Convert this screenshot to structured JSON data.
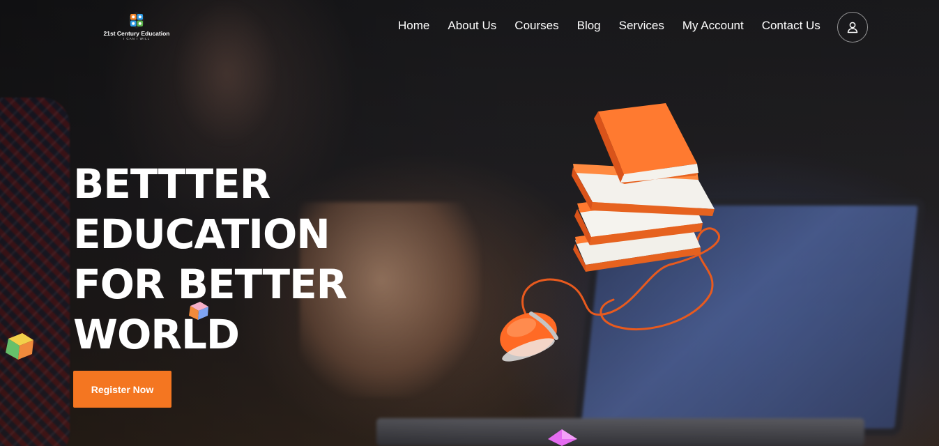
{
  "brand": {
    "name": "21st Century Education",
    "tagline": "I CAN I WILL",
    "colors": {
      "accent": "#f47621",
      "logo_blue": "#2e9be3",
      "logo_orange": "#f2862b",
      "logo_green": "#5bb34a",
      "logo_red": "#e04b4b"
    }
  },
  "nav": {
    "items": [
      {
        "label": "Home"
      },
      {
        "label": "About Us"
      },
      {
        "label": "Courses"
      },
      {
        "label": "Blog"
      },
      {
        "label": "Services"
      },
      {
        "label": "My Account"
      },
      {
        "label": "Contact Us"
      }
    ],
    "account_icon": "user-icon"
  },
  "hero": {
    "headline_lines": [
      "BETTTER",
      "EDUCATION",
      "FOR BETTER",
      "WORLD"
    ],
    "cta_label": "Register Now",
    "illustration": "books-with-mouse",
    "decorations": [
      "cube-icon",
      "cube-icon",
      "gem-icon"
    ]
  }
}
